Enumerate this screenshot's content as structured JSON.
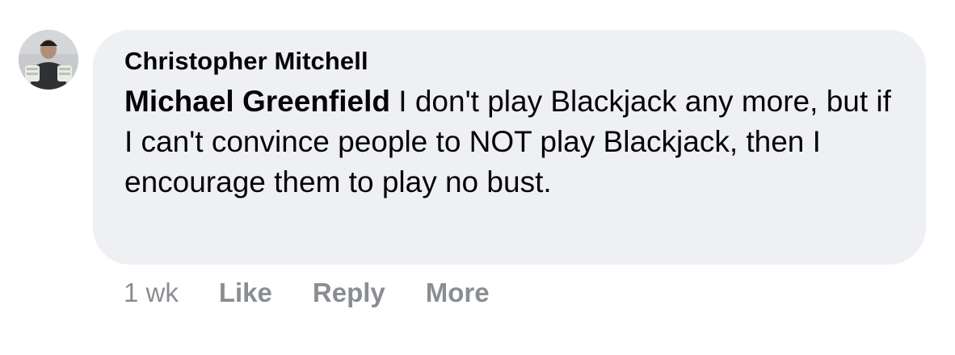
{
  "comment": {
    "author": "Christopher Mitchell",
    "mention": "Michael Greenfield",
    "text": " I don't play Blackjack any more, but if I can't convince people to NOT play Blackjack, then I encourage them to play no bust.",
    "avatar_icon": "user-avatar-photo",
    "bubble_color": "#eff0f4"
  },
  "actions": {
    "timestamp": "1 wk",
    "like_label": "Like",
    "reply_label": "Reply",
    "more_label": "More",
    "text_color": "#8a8d91"
  }
}
